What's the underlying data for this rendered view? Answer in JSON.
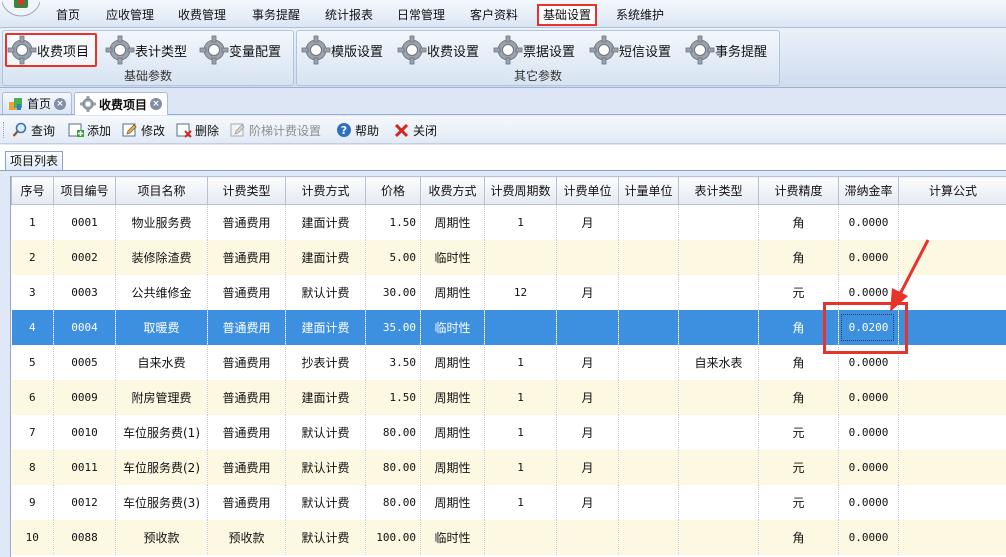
{
  "menu": {
    "items": [
      "首页",
      "应收管理",
      "收费管理",
      "事务提醒",
      "统计报表",
      "日常管理",
      "客户资料",
      "基础设置",
      "系统维护"
    ],
    "active": "基础设置"
  },
  "ribbon": {
    "groups": [
      {
        "label": "基础参数",
        "buttons": [
          "收费项目",
          "表计类型",
          "变量配置"
        ]
      },
      {
        "label": "其它参数",
        "buttons": [
          "模版设置",
          "收费设置",
          "票据设置",
          "短信设置",
          "事务提醒"
        ]
      }
    ],
    "selected": "收费项目"
  },
  "doc_tabs": [
    {
      "label": "首页",
      "icon": "home-icon"
    },
    {
      "label": "收费项目",
      "icon": "gear-icon"
    }
  ],
  "toolbar": {
    "buttons": [
      {
        "label": "查询",
        "icon": "search-icon",
        "enabled": true
      },
      {
        "label": "添加",
        "icon": "add-icon",
        "enabled": true
      },
      {
        "label": "修改",
        "icon": "edit-icon",
        "enabled": true
      },
      {
        "label": "删除",
        "icon": "delete-icon",
        "enabled": true
      },
      {
        "label": "阶梯计费设置",
        "icon": "tier-settings-icon",
        "enabled": false
      },
      {
        "label": "帮助",
        "icon": "help-icon",
        "enabled": true
      },
      {
        "label": "关闭",
        "icon": "close-icon",
        "enabled": true
      }
    ]
  },
  "panel": {
    "tab_label": "项目列表"
  },
  "grid": {
    "columns": [
      "序号",
      "项目编号",
      "项目名称",
      "计费类型",
      "计费方式",
      "价格",
      "收费方式",
      "计费周期数",
      "计费单位",
      "计量单位",
      "表计类型",
      "计费精度",
      "滞纳金率",
      "计算公式"
    ],
    "rows": [
      [
        "1",
        "0001",
        "物业服务费",
        "普通费用",
        "建面计费",
        "1.50",
        "周期性",
        "1",
        "月",
        "",
        "",
        "角",
        "0.0000",
        ""
      ],
      [
        "2",
        "0002",
        "装修除渣费",
        "普通费用",
        "建面计费",
        "5.00",
        "临时性",
        "",
        "",
        "",
        "",
        "角",
        "0.0000",
        ""
      ],
      [
        "3",
        "0003",
        "公共维修金",
        "普通费用",
        "默认计费",
        "30.00",
        "周期性",
        "12",
        "月",
        "",
        "",
        "元",
        "0.0000",
        ""
      ],
      [
        "4",
        "0004",
        "取暖费",
        "普通费用",
        "建面计费",
        "35.00",
        "临时性",
        "",
        "",
        "",
        "",
        "角",
        "0.0200",
        ""
      ],
      [
        "5",
        "0005",
        "自来水费",
        "普通费用",
        "抄表计费",
        "3.50",
        "周期性",
        "1",
        "月",
        "",
        "自来水表",
        "角",
        "0.0000",
        ""
      ],
      [
        "6",
        "0009",
        "附房管理费",
        "普通费用",
        "建面计费",
        "1.50",
        "周期性",
        "1",
        "月",
        "",
        "",
        "角",
        "0.0000",
        ""
      ],
      [
        "7",
        "0010",
        "车位服务费(1)",
        "普通费用",
        "默认计费",
        "80.00",
        "周期性",
        "1",
        "月",
        "",
        "",
        "元",
        "0.0000",
        ""
      ],
      [
        "8",
        "0011",
        "车位服务费(2)",
        "普通费用",
        "默认计费",
        "80.00",
        "周期性",
        "1",
        "月",
        "",
        "",
        "元",
        "0.0000",
        ""
      ],
      [
        "9",
        "0012",
        "车位服务费(3)",
        "普通费用",
        "默认计费",
        "80.00",
        "周期性",
        "1",
        "月",
        "",
        "",
        "元",
        "0.0000",
        ""
      ],
      [
        "10",
        "0088",
        "预收款",
        "预收款",
        "默认计费",
        "100.00",
        "临时性",
        "",
        "",
        "",
        "",
        "角",
        "0.0000",
        ""
      ]
    ],
    "selected_row": 3,
    "highlighted_cell": "滞纳金率"
  },
  "colors": {
    "selection": "#3d8fe0",
    "alt_row": "#fdf8e2",
    "annotation": "#e8322c"
  }
}
